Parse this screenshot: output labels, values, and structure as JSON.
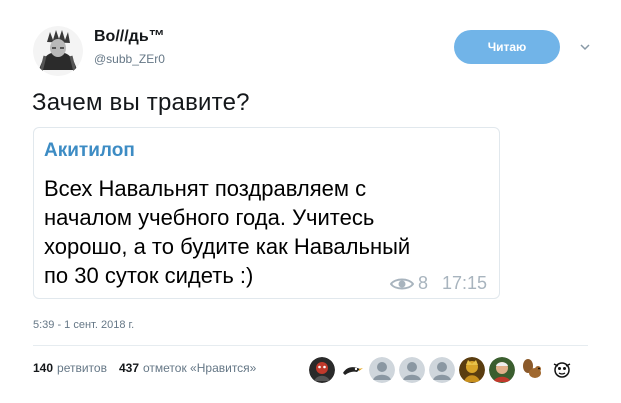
{
  "author": {
    "name": "Bo///дь™",
    "handle": "@subb_ZEr0"
  },
  "follow_button": {
    "label": "Читаю",
    "color": "#71b4e8"
  },
  "tweet": {
    "text": "Зачем вы травите?"
  },
  "quoted_card": {
    "author": "Акитилоп",
    "author_color": "#3d8cc4",
    "lines": [
      "Всех Навальнят поздравляем с",
      "началом учебного года. Учитесь",
      "хорошо, а то будите как Навальный",
      "по 30 суток сидеть :)"
    ],
    "views": "8",
    "time": "17:15"
  },
  "timestamp": "5:39 - 1 сент. 2018 г.",
  "stats": {
    "retweets_count": "140",
    "retweets_label": "ретвитов",
    "likes_count": "437",
    "likes_label": "отметок «Нравится»"
  },
  "likers": [
    {
      "icon": "avatar-dark-face-icon"
    },
    {
      "icon": "avatar-bird-icon"
    },
    {
      "icon": "avatar-default-icon"
    },
    {
      "icon": "avatar-default-icon"
    },
    {
      "icon": "avatar-default-icon"
    },
    {
      "icon": "avatar-golden-figure-icon"
    },
    {
      "icon": "avatar-portrait-icon"
    },
    {
      "icon": "avatar-squirrel-icon"
    },
    {
      "icon": "avatar-cartoon-icon"
    }
  ]
}
